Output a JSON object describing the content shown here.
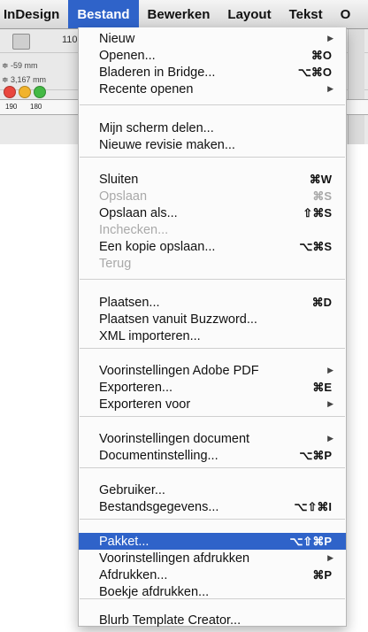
{
  "menubar": {
    "items": [
      {
        "label": "InDesign"
      },
      {
        "label": "Bestand"
      },
      {
        "label": "Bewerken"
      },
      {
        "label": "Layout"
      },
      {
        "label": "Tekst"
      },
      {
        "label": "O"
      }
    ]
  },
  "background": {
    "zoom": "110",
    "coord_x": "≑ -59 mm",
    "coord_y": "≑ 3,167 mm",
    "ruler": [
      "190",
      "180"
    ]
  },
  "menu": {
    "items": [
      {
        "label": "Nieuw",
        "shortcut": "",
        "submenu": true,
        "disabled": false
      },
      {
        "label": "Openen...",
        "shortcut": "⌘O",
        "submenu": false,
        "disabled": false
      },
      {
        "label": "Bladeren in Bridge...",
        "shortcut": "⌥⌘O",
        "submenu": false,
        "disabled": false
      },
      {
        "label": "Recente openen",
        "shortcut": "",
        "submenu": true,
        "disabled": false
      },
      {
        "label": "Mijn scherm delen...",
        "shortcut": "",
        "submenu": false,
        "disabled": false
      },
      {
        "label": "Nieuwe revisie maken...",
        "shortcut": "",
        "submenu": false,
        "disabled": false
      },
      {
        "label": "Sluiten",
        "shortcut": "⌘W",
        "submenu": false,
        "disabled": false
      },
      {
        "label": "Opslaan",
        "shortcut": "⌘S",
        "submenu": false,
        "disabled": true
      },
      {
        "label": "Opslaan als...",
        "shortcut": "⇧⌘S",
        "submenu": false,
        "disabled": false
      },
      {
        "label": "Inchecken...",
        "shortcut": "",
        "submenu": false,
        "disabled": true
      },
      {
        "label": "Een kopie opslaan...",
        "shortcut": "⌥⌘S",
        "submenu": false,
        "disabled": false
      },
      {
        "label": "Terug",
        "shortcut": "",
        "submenu": false,
        "disabled": true
      },
      {
        "label": "Plaatsen...",
        "shortcut": "⌘D",
        "submenu": false,
        "disabled": false
      },
      {
        "label": "Plaatsen vanuit Buzzword...",
        "shortcut": "",
        "submenu": false,
        "disabled": false
      },
      {
        "label": "XML importeren...",
        "shortcut": "",
        "submenu": false,
        "disabled": false
      },
      {
        "label": "Voorinstellingen Adobe PDF",
        "shortcut": "",
        "submenu": true,
        "disabled": false
      },
      {
        "label": "Exporteren...",
        "shortcut": "⌘E",
        "submenu": false,
        "disabled": false
      },
      {
        "label": "Exporteren voor",
        "shortcut": "",
        "submenu": true,
        "disabled": false
      },
      {
        "label": "Voorinstellingen document",
        "shortcut": "",
        "submenu": true,
        "disabled": false
      },
      {
        "label": "Documentinstelling...",
        "shortcut": "⌥⌘P",
        "submenu": false,
        "disabled": false
      },
      {
        "label": "Gebruiker...",
        "shortcut": "",
        "submenu": false,
        "disabled": false
      },
      {
        "label": "Bestandsgegevens...",
        "shortcut": "⌥⇧⌘I",
        "submenu": false,
        "disabled": false
      },
      {
        "label": "Pakket...",
        "shortcut": "⌥⇧⌘P",
        "submenu": false,
        "disabled": false,
        "highlighted": true
      },
      {
        "label": "Voorinstellingen afdrukken",
        "shortcut": "",
        "submenu": true,
        "disabled": false
      },
      {
        "label": "Afdrukken...",
        "shortcut": "⌘P",
        "submenu": false,
        "disabled": false
      },
      {
        "label": "Boekje afdrukken...",
        "shortcut": "",
        "submenu": false,
        "disabled": false
      },
      {
        "label": "Blurb Template Creator...",
        "shortcut": "",
        "submenu": false,
        "disabled": false
      }
    ],
    "arrow_glyph": "▶"
  },
  "colors": {
    "highlight": "#2f63c9",
    "disabled_text": "#a9a9a9"
  }
}
